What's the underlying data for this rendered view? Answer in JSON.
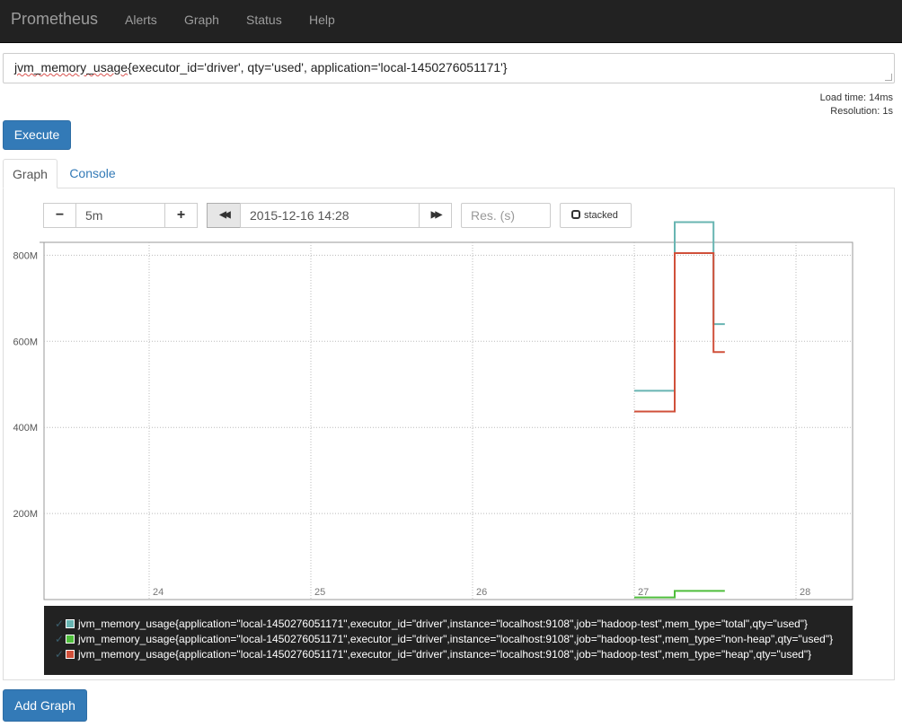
{
  "navbar": {
    "brand": "Prometheus",
    "items": [
      "Alerts",
      "Graph",
      "Status",
      "Help"
    ]
  },
  "expression": {
    "prefix": "jvm_memory_usage",
    "rest": "{executor_id='driver', qty='used', application='local-1450276051171'}"
  },
  "eval_stats": {
    "load_time": "Load time: 14ms",
    "resolution": "Resolution: 1s"
  },
  "execute_label": "Execute",
  "tabs": [
    "Graph",
    "Console"
  ],
  "controls": {
    "minus": "−",
    "range": "5m",
    "plus": "+",
    "back": "◀◀",
    "end_time": "2015-12-16 14:28",
    "forward": "▶▶",
    "res_placeholder": "Res. (s)",
    "stacked": "stacked"
  },
  "chart_data": {
    "type": "line",
    "y_ticks": [
      "800M",
      "600M",
      "400M",
      "200M"
    ],
    "y_tick_values": [
      800,
      600,
      400,
      200
    ],
    "x_ticks": [
      "24",
      "25",
      "26",
      "27",
      "28"
    ],
    "x_tick_values": [
      24,
      25,
      26,
      27,
      28
    ],
    "xlim": [
      23.35,
      28.35
    ],
    "ylim": [
      0,
      830
    ],
    "grid": true,
    "series": [
      {
        "color": "#68b5b2",
        "points": [
          [
            27.0,
            485
          ],
          [
            27.25,
            485
          ],
          [
            27.25,
            877
          ],
          [
            27.49,
            877
          ],
          [
            27.49,
            640
          ],
          [
            27.56,
            640
          ]
        ]
      },
      {
        "color": "#4fbe3c",
        "points": [
          [
            27.0,
            5
          ],
          [
            27.25,
            5
          ],
          [
            27.25,
            20
          ],
          [
            27.56,
            20
          ]
        ]
      },
      {
        "color": "#d0503a",
        "points": [
          [
            27.0,
            437
          ],
          [
            27.25,
            437
          ],
          [
            27.25,
            805
          ],
          [
            27.49,
            805
          ],
          [
            27.49,
            575
          ],
          [
            27.56,
            575
          ]
        ]
      }
    ]
  },
  "legend": [
    {
      "color": "#68b5b2",
      "label": "jvm_memory_usage{application=\"local-1450276051171\",executor_id=\"driver\",instance=\"localhost:9108\",job=\"hadoop-test\",mem_type=\"total\",qty=\"used\"}"
    },
    {
      "color": "#4fbe3c",
      "label": "jvm_memory_usage{application=\"local-1450276051171\",executor_id=\"driver\",instance=\"localhost:9108\",job=\"hadoop-test\",mem_type=\"non-heap\",qty=\"used\"}"
    },
    {
      "color": "#d0503a",
      "label": "jvm_memory_usage{application=\"local-1450276051171\",executor_id=\"driver\",instance=\"localhost:9108\",job=\"hadoop-test\",mem_type=\"heap\",qty=\"used\"}"
    }
  ],
  "add_graph_label": "Add Graph"
}
